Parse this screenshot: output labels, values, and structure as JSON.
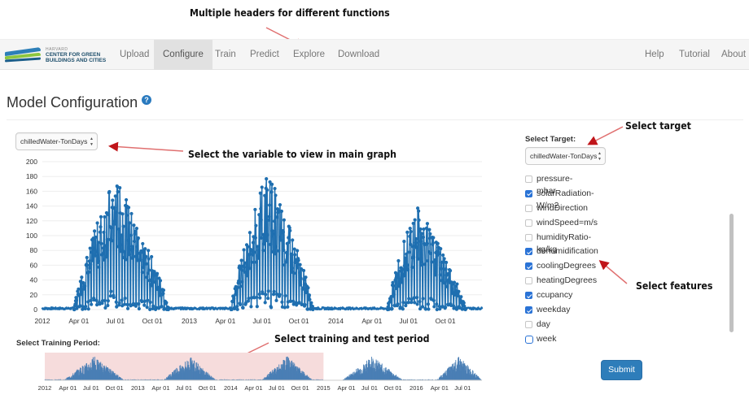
{
  "annotations": {
    "headers": "Multiple headers for different functions",
    "variable": "Select the variable to view in main graph",
    "target": "Select target",
    "features": "Select features",
    "period": "Select training and test period"
  },
  "nav": {
    "logo_small": "HARVARD",
    "logo_text": "CENTER FOR GREEN BUILDINGS AND CITIES",
    "items": [
      {
        "label": "Upload"
      },
      {
        "label": "Configure",
        "active": true
      },
      {
        "label": "Train"
      },
      {
        "label": "Predict"
      },
      {
        "label": "Explore"
      },
      {
        "label": "Download"
      }
    ],
    "right_items": [
      {
        "label": "Help"
      },
      {
        "label": "Tutorial"
      },
      {
        "label": "About"
      }
    ]
  },
  "page": {
    "title": "Model Configuration",
    "help_icon": "question-circle-icon"
  },
  "variable_select": {
    "value": "chilledWater-TonDays"
  },
  "target": {
    "label": "Select Target:",
    "value": "chilledWater-TonDays"
  },
  "features": [
    {
      "label": "pressure-mbar",
      "checked": false
    },
    {
      "label": "solarRadiation-W/m2",
      "checked": true
    },
    {
      "label": "windDirection",
      "checked": false
    },
    {
      "label": "windSpeed=m/s",
      "checked": false
    },
    {
      "label": "humidityRatio-kg/kg",
      "checked": false
    },
    {
      "label": "dehumidification",
      "checked": true
    },
    {
      "label": "coolingDegrees",
      "checked": true
    },
    {
      "label": "heatingDegrees",
      "checked": false
    },
    {
      "label": "ccupancy",
      "checked": true
    },
    {
      "label": "weekday",
      "checked": true
    },
    {
      "label": "day",
      "checked": false
    },
    {
      "label": "week",
      "checked": false,
      "focused": true
    }
  ],
  "submit_label": "Submit",
  "training_label": "Select Training Period:",
  "colors": {
    "series": "#1f6fb0",
    "accent": "#2e7dba",
    "annotation_arrow": "#c0151a",
    "brush_selection": "#f6dcdc"
  },
  "chart_data": [
    {
      "type": "scatter",
      "ylim": [
        0,
        200
      ],
      "yticks": [
        "0",
        "20",
        "40",
        "60",
        "80",
        "100",
        "120",
        "140",
        "160",
        "180",
        "200"
      ],
      "xticks": [
        "2012",
        "Apr 01",
        "Jul 01",
        "Oct 01",
        "2013",
        "Apr 01",
        "Jul 01",
        "Oct 01",
        "2014",
        "Apr 01",
        "Jul 01",
        "Oct 01"
      ],
      "xlim": [
        "2012-01-01",
        "2014-12-31"
      ],
      "seasons": [
        {
          "start": "2012-03-20",
          "end": "2012-11-10",
          "peak_date": "2012-06-28",
          "peak": 182
        },
        {
          "start": "2013-04-15",
          "end": "2013-11-05",
          "peak_date": "2013-07-15",
          "peak": 190
        },
        {
          "start": "2014-05-10",
          "end": "2014-11-20",
          "peak_date": "2014-07-20",
          "peak": 143
        }
      ]
    },
    {
      "type": "area",
      "xticks": [
        "2012",
        "Apr 01",
        "Jul 01",
        "Oct 01",
        "2013",
        "Apr 01",
        "Jul 01",
        "Oct 01",
        "2014",
        "Apr 01",
        "Jul 01",
        "Oct 01",
        "2015",
        "Apr 01",
        "Jul 01",
        "Oct 01",
        "2016",
        "Apr 01",
        "Jul 01"
      ],
      "xlim": [
        "2012-01-01",
        "2016-09-15"
      ],
      "selection": [
        "2012-01-01",
        "2015-01-01"
      ],
      "gap": [
        "2015-01-01",
        "2015-03-15"
      ]
    }
  ]
}
